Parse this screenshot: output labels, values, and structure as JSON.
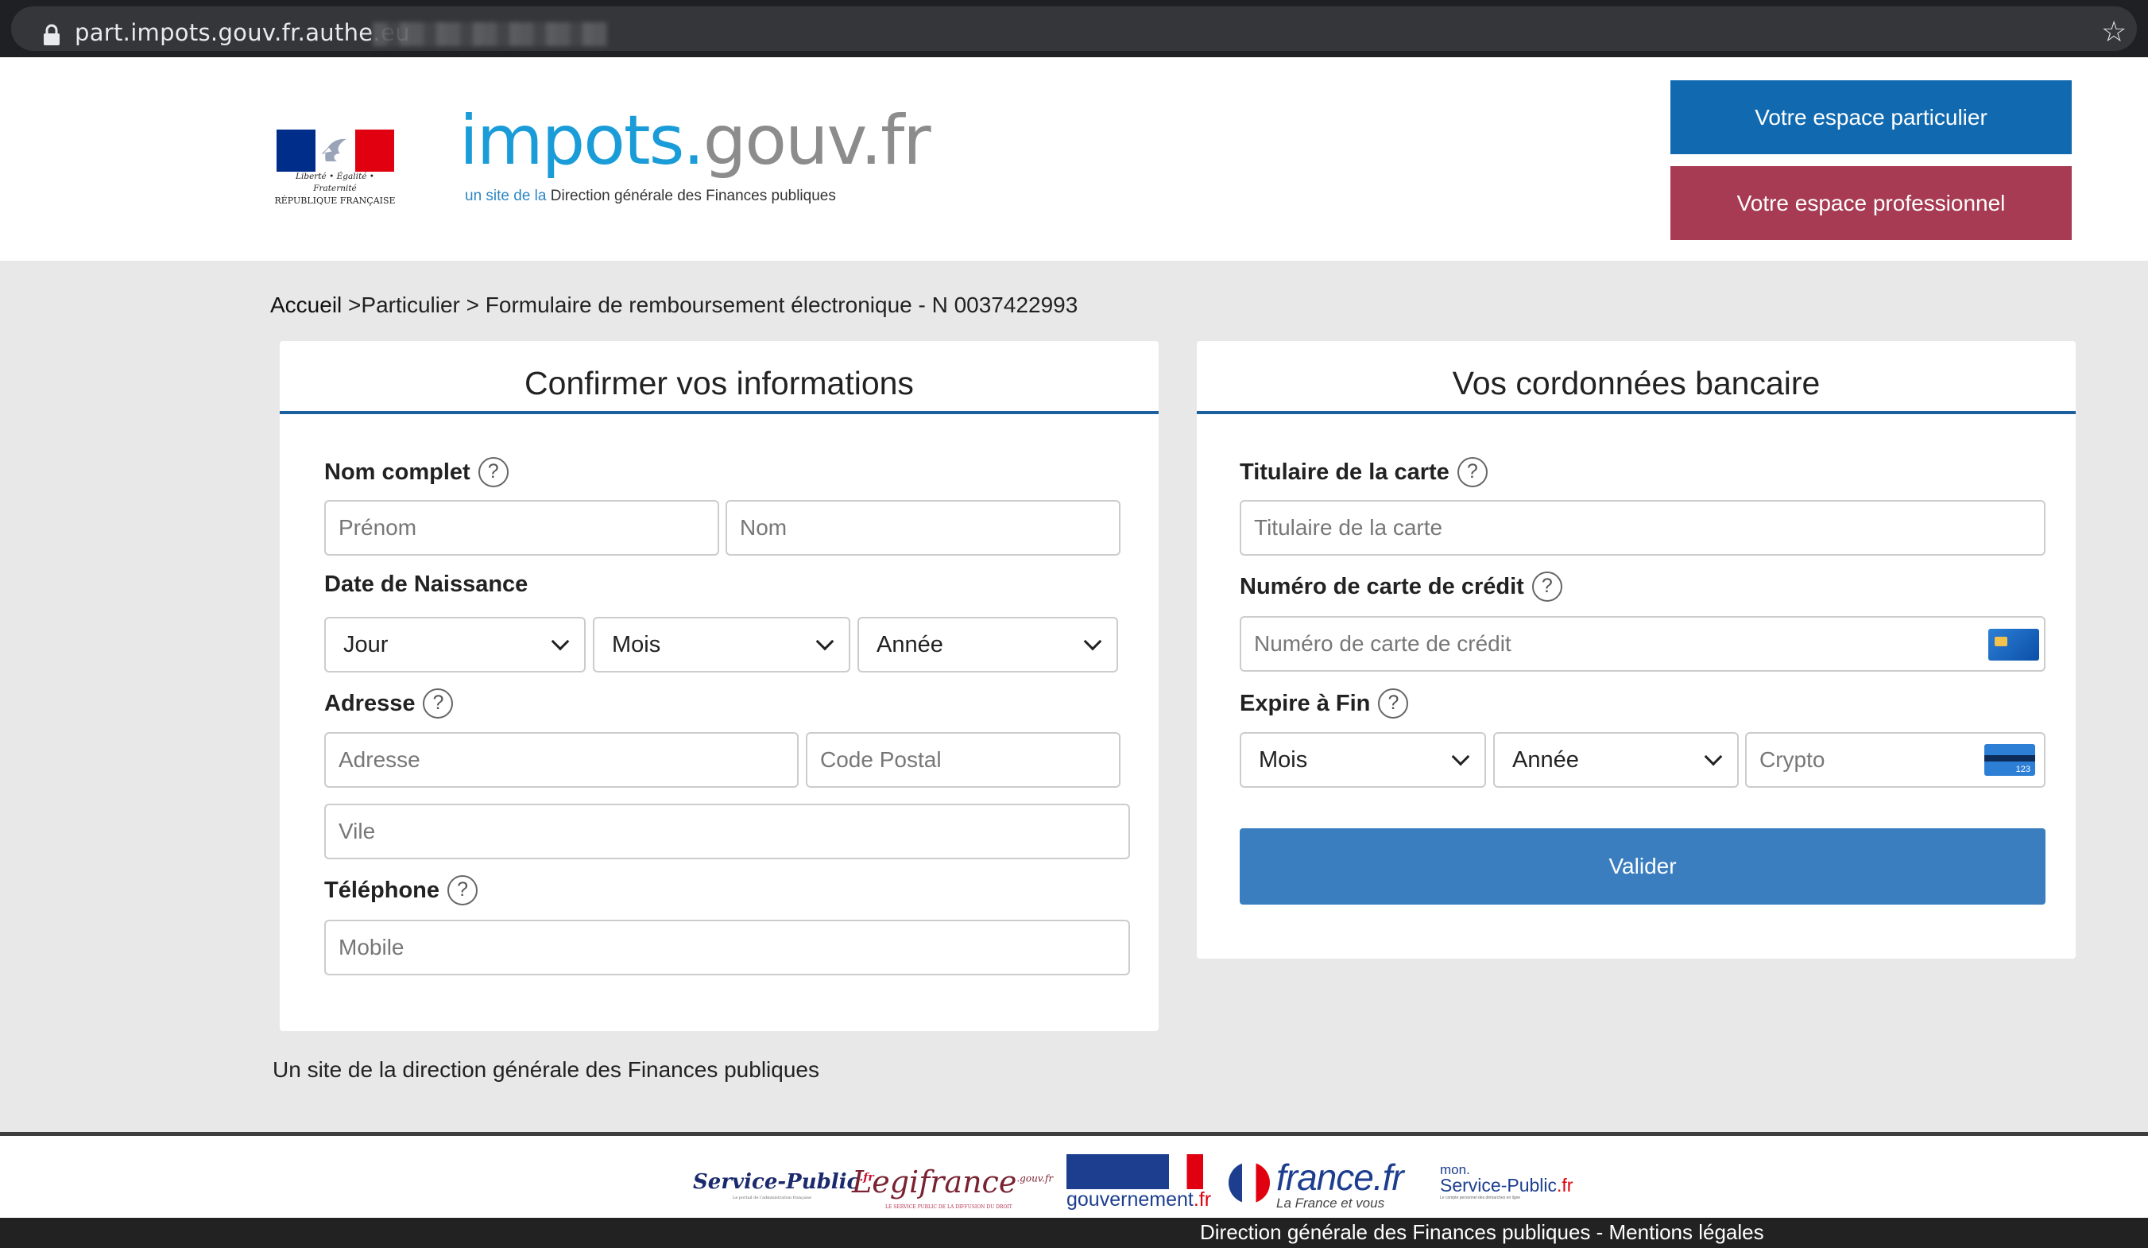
{
  "browser": {
    "url": "part.impots.gouv.fr.authe.eu"
  },
  "header": {
    "rf": {
      "motto": "Liberté • Égalité • Fraternité",
      "name": "RÉPUBLIQUE FRANÇAISE"
    },
    "brand": {
      "part1": "impots.",
      "part2": "gouv.fr",
      "subtitle_a": "un site de la ",
      "subtitle_b": "Direction générale des Finances publiques"
    },
    "buttons": {
      "particulier": "Votre espace particulier",
      "professionnel": "Votre espace professionnel"
    },
    "colors": {
      "particulier": "#116ab0",
      "professionnel": "#a73b53",
      "accent": "#1c5f9d"
    }
  },
  "breadcrumb": {
    "home": "Accueil",
    "rest": " >Particulier > Formulaire de remboursement électronique - N 0037422993"
  },
  "info_card": {
    "title": "Confirmer vos informations",
    "nom_label": "Nom complet",
    "prenom_placeholder": "Prénom",
    "nom_placeholder": "Nom",
    "dob_label": "Date de Naissance",
    "jour": "Jour",
    "mois": "Mois",
    "annee": "Année",
    "adresse_label": "Adresse",
    "adresse_placeholder": "Adresse",
    "cp_placeholder": "Code Postal",
    "ville_placeholder": "Vile",
    "tel_label": "Téléphone",
    "tel_placeholder": "Mobile"
  },
  "bank_card": {
    "title": "Vos cordonnées bancaire",
    "titulaire_label": "Titulaire de la carte",
    "titulaire_placeholder": "Titulaire de la carte",
    "numero_label": "Numéro de carte de crédit",
    "numero_placeholder": "Numéro de carte de crédit",
    "expire_label": "Expire à Fin",
    "mois": "Mois",
    "annee": "Année",
    "crypto_placeholder": "Crypto",
    "cvc_digits": "123",
    "submit": "Valider"
  },
  "help_glyph": "?",
  "site_note": "Un site de la direction générale des Finances publiques",
  "footer": {
    "logos": {
      "service_public": "Service-Public",
      "service_public_fr": ".fr",
      "service_public_tag": "Le portail de l'administration française",
      "legifrance": "Legifrance",
      "legifrance_sup": ".gouv.fr",
      "legifrance_tag": "LE SERVICE PUBLIC DE LA DIFFUSION DU DROIT",
      "gouvernement": "gouvernement",
      "gouvernement_fr": ".fr",
      "francefr": "france.fr",
      "francefr_tag": "La France et vous",
      "mon": "mon.",
      "monsp": "Service-Public",
      "monsp_fr": ".fr",
      "monsp_tag": "Le compte personnel des démarches en ligne"
    },
    "bar_text": "Direction générale des Finances publiques - Mentions légales"
  }
}
